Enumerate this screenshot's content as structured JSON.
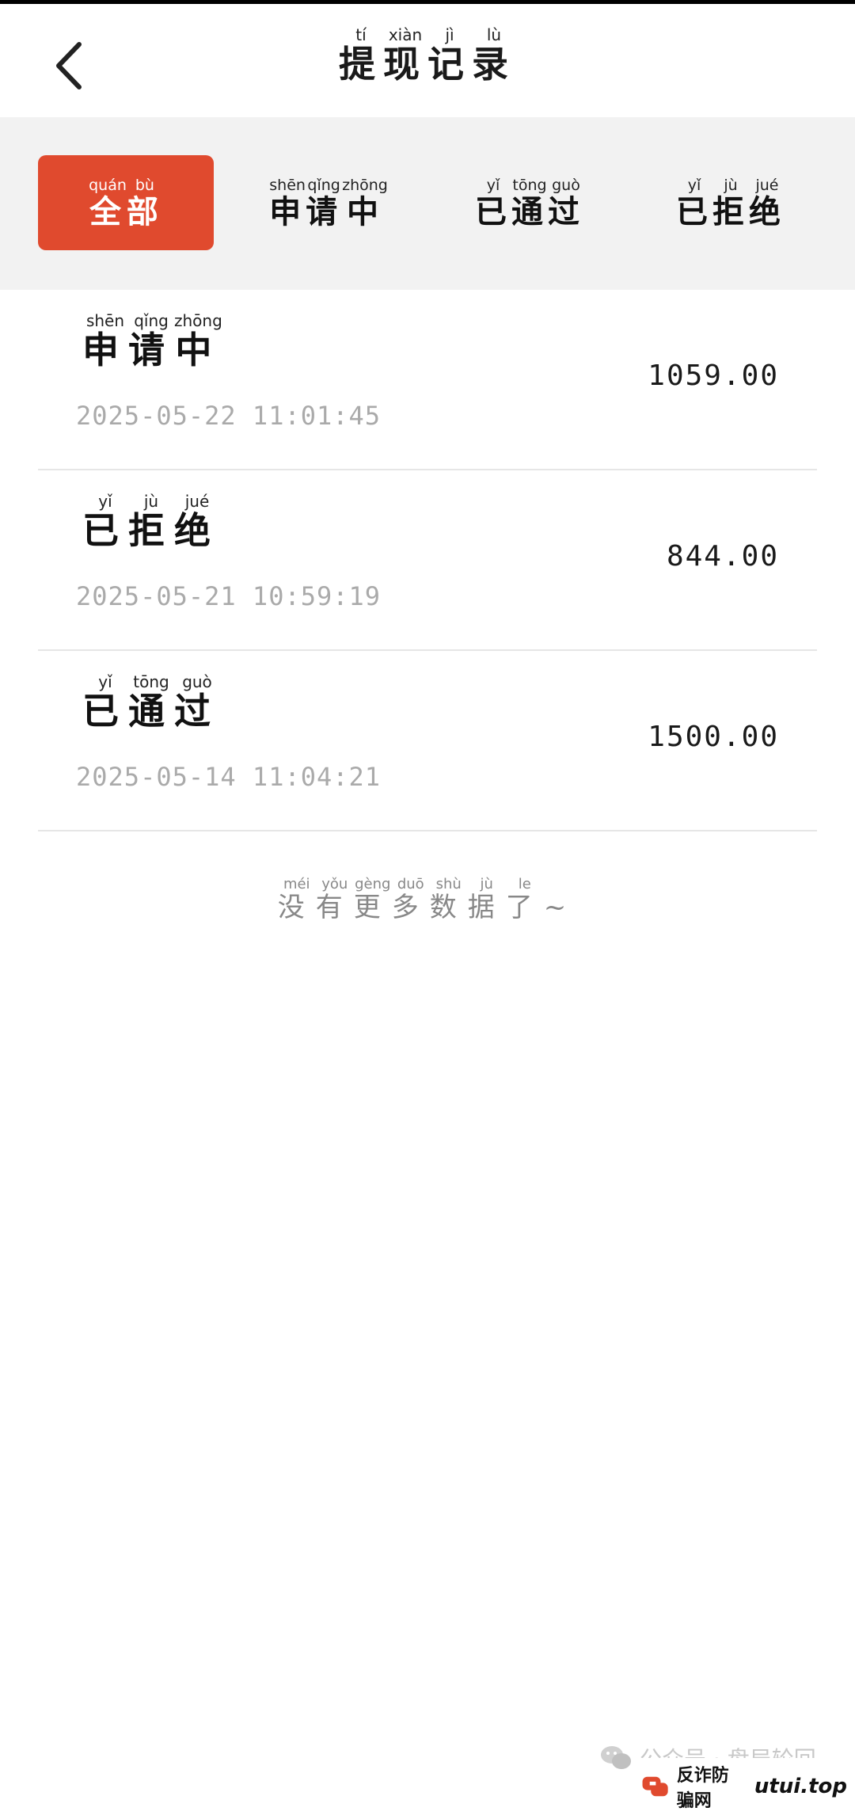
{
  "header": {
    "title": [
      {
        "char": "提",
        "pinyin": "tí"
      },
      {
        "char": "现",
        "pinyin": "xiàn"
      },
      {
        "char": "记",
        "pinyin": "jì"
      },
      {
        "char": "录",
        "pinyin": "lù"
      }
    ]
  },
  "tabs": [
    {
      "active": true,
      "chars": [
        {
          "char": "全",
          "pinyin": "quán"
        },
        {
          "char": "部",
          "pinyin": "bù"
        }
      ]
    },
    {
      "active": false,
      "chars": [
        {
          "char": "申",
          "pinyin": "shēn"
        },
        {
          "char": "请",
          "pinyin": "qǐng"
        },
        {
          "char": "中",
          "pinyin": "zhōng"
        }
      ]
    },
    {
      "active": false,
      "chars": [
        {
          "char": "已",
          "pinyin": "yǐ"
        },
        {
          "char": "通",
          "pinyin": "tōng"
        },
        {
          "char": "过",
          "pinyin": "guò"
        }
      ]
    },
    {
      "active": false,
      "chars": [
        {
          "char": "已",
          "pinyin": "yǐ"
        },
        {
          "char": "拒",
          "pinyin": "jù"
        },
        {
          "char": "绝",
          "pinyin": "jué"
        }
      ]
    }
  ],
  "records": [
    {
      "status": [
        {
          "char": "申",
          "pinyin": "shēn"
        },
        {
          "char": "请",
          "pinyin": "qǐng"
        },
        {
          "char": "中",
          "pinyin": "zhōng"
        }
      ],
      "time": "2025-05-22 11:01:45",
      "amount": "1059.00"
    },
    {
      "status": [
        {
          "char": "已",
          "pinyin": "yǐ"
        },
        {
          "char": "拒",
          "pinyin": "jù"
        },
        {
          "char": "绝",
          "pinyin": "jué"
        }
      ],
      "time": "2025-05-21 10:59:19",
      "amount": "844.00"
    },
    {
      "status": [
        {
          "char": "已",
          "pinyin": "yǐ"
        },
        {
          "char": "通",
          "pinyin": "tōng"
        },
        {
          "char": "过",
          "pinyin": "guò"
        }
      ],
      "time": "2025-05-14 11:04:21",
      "amount": "1500.00"
    }
  ],
  "footer": {
    "no_more": [
      {
        "char": "没",
        "pinyin": "méi"
      },
      {
        "char": "有",
        "pinyin": "yǒu"
      },
      {
        "char": "更",
        "pinyin": "gèng"
      },
      {
        "char": "多",
        "pinyin": "duō"
      },
      {
        "char": "数",
        "pinyin": "shù"
      },
      {
        "char": "据",
        "pinyin": "jù"
      },
      {
        "char": "了",
        "pinyin": "le"
      }
    ],
    "no_more_suffix": "~"
  },
  "watermark": {
    "text": "公众号 · 盘局轮回",
    "brand_name": "反诈防骗网",
    "brand_domain": "utui.top"
  },
  "colors": {
    "active_tab": "#e04a2e",
    "tab_bar_bg": "#f2f2f2",
    "time_text": "#aaaaaa"
  },
  "icons": {
    "back": "chevron-left-icon",
    "wechat": "wechat-icon",
    "brand": "brand-logo-icon"
  }
}
